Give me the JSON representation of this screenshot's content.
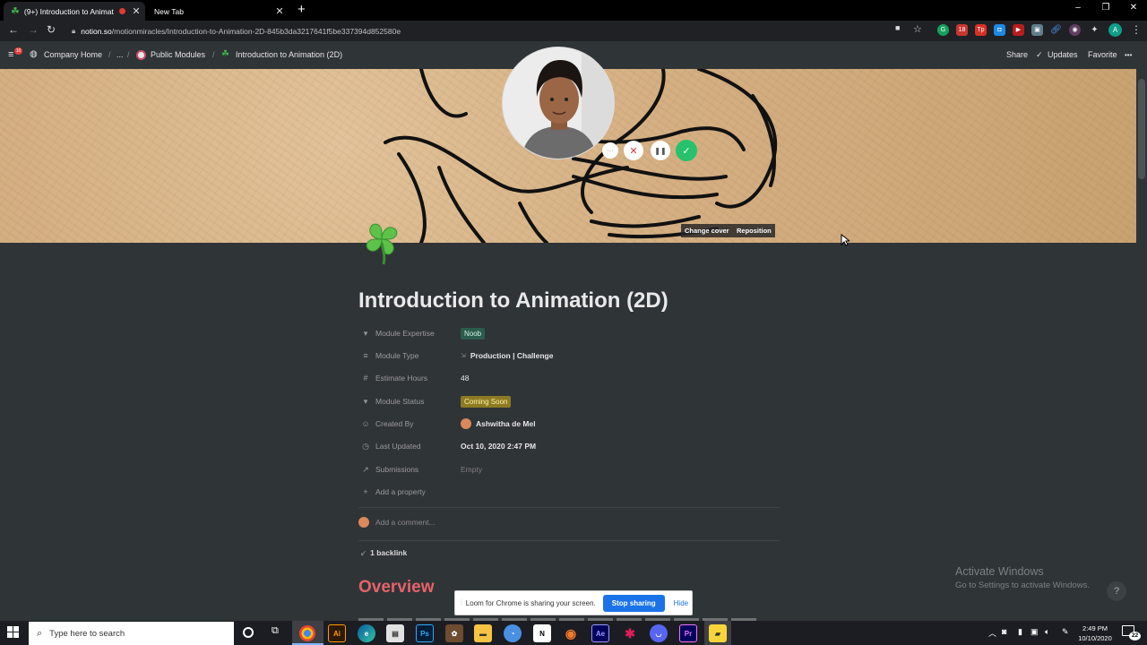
{
  "browser": {
    "tabs": [
      {
        "title": "(9+) Introduction to Animati",
        "active": true
      },
      {
        "title": "New Tab",
        "active": false
      }
    ],
    "new_tab": "+",
    "window_controls": [
      "–",
      "❐",
      "✕"
    ],
    "url_host": "notion.so",
    "url_path": "/motionmiracles/Introduction-to-Animation-2D-845b3da3217641f5be337394d852580e",
    "extension_badge": "18",
    "profile_initial": "A"
  },
  "notion_bar": {
    "breadcrumbs": [
      "Company Home",
      "...",
      "Public Modules",
      "Introduction to Animation (2D)"
    ],
    "separator": "/",
    "share": "Share",
    "updates": "Updates",
    "favorite": "Favorite",
    "more": "•••"
  },
  "cover": {
    "change_cover": "Change cover",
    "reposition": "Reposition",
    "cam_controls": [
      "···",
      "✕",
      "❚❚",
      "✓"
    ]
  },
  "page": {
    "title": "Introduction to Animation (2D)",
    "properties": [
      {
        "icon": "▾",
        "icon_name": "select-icon",
        "name": "Module Expertise",
        "value": "Noob",
        "kind": "tag-green"
      },
      {
        "icon": "≡",
        "icon_name": "text-icon",
        "name": "Module Type",
        "value": "Production | Challenge",
        "prefix": "⇲",
        "kind": "text"
      },
      {
        "icon": "#",
        "icon_name": "number-icon",
        "name": "Estimate Hours",
        "value": "48",
        "kind": "text"
      },
      {
        "icon": "▾",
        "icon_name": "select-icon",
        "name": "Module Status",
        "value": "Coming Soon",
        "kind": "tag-yellow"
      },
      {
        "icon": "☺",
        "icon_name": "person-icon",
        "name": "Created By",
        "value": "Ashwitha de Mel",
        "kind": "person"
      },
      {
        "icon": "◷",
        "icon_name": "clock-icon",
        "name": "Last Updated",
        "value": "Oct 10, 2020 2:47 PM",
        "kind": "text"
      },
      {
        "icon": "↗",
        "icon_name": "relation-icon",
        "name": "Submissions",
        "value": "Empty",
        "kind": "empty"
      }
    ],
    "add_property": "Add a property",
    "add_comment": "Add a comment...",
    "backlink": "1 backlink",
    "overview": "Overview"
  },
  "loom": {
    "message": "Loom for Chrome is sharing your screen.",
    "stop": "Stop sharing",
    "hide": "Hide"
  },
  "watermark": {
    "line1": "Activate Windows",
    "line2": "Go to Settings to activate Windows."
  },
  "help": "?",
  "taskbar": {
    "search_placeholder": "Type here to search",
    "apps": [
      "Chrome",
      "Ai",
      "Edge",
      "Store",
      "Ps",
      "App",
      "Explorer",
      "Browser",
      "N",
      "Blender",
      "Ae",
      "Slack",
      "Discord",
      "Pr",
      "Notes"
    ],
    "time": "2:49 PM",
    "date": "10/10/2020",
    "notifications": "22"
  },
  "colors": {
    "notion_bg": "#2f3437",
    "overview_red": "#e5636a",
    "tag_green": "#2b5c4c",
    "tag_yellow": "#8c7b22",
    "loom_blue": "#1a73e8"
  }
}
